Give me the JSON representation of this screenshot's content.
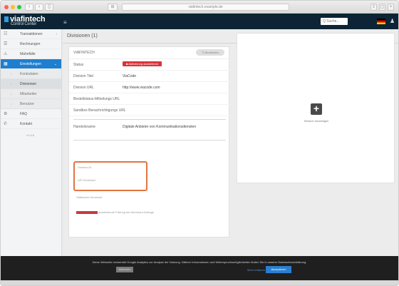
{
  "browser": {
    "url": "viafintech.example.de",
    "tab_icon": "⊞"
  },
  "header": {
    "logo_text": "viafintech",
    "logo_sub": "Control Center",
    "search_placeholder": "Q Suche...",
    "flag": "DE"
  },
  "sidebar": {
    "items": [
      {
        "icon": "☷",
        "label": "Transaktionen",
        "chev": "›"
      },
      {
        "icon": "☰",
        "label": "Rechnungen",
        "chev": ""
      },
      {
        "icon": "⚠",
        "label": "Mahnfälle",
        "chev": ""
      },
      {
        "icon": "▦",
        "label": "Einstellungen",
        "chev": "⌄"
      }
    ],
    "sub_items": [
      {
        "label": "Kontodaten"
      },
      {
        "label": "Divisionen"
      },
      {
        "label": "Mitarbeiter"
      },
      {
        "label": "Benutzer"
      }
    ],
    "bottom_items": [
      {
        "icon": "⚙",
        "label": "FAQ"
      },
      {
        "icon": "✆",
        "label": "Kontakt"
      }
    ],
    "version": "v1.4.8"
  },
  "main": {
    "page_title": "Divisionen (1)",
    "card_title": "VIAFINTECH",
    "edit_button": "✎ Bearbeiten",
    "rows": [
      {
        "key": "Status",
        "value": ""
      },
      {
        "key": "Division Titel",
        "value": "ViaCode"
      },
      {
        "key": "Division URL",
        "value": "http://www.viacode.com"
      },
      {
        "key": "Bestellstatus-Mitteilungs URL",
        "value": ""
      },
      {
        "key": "Sandbox Benachrichtigungs URL",
        "value": ""
      },
      {
        "key": "Handelsname",
        "value": "Digitale Anbieter von Kommunikationsdiensten"
      }
    ],
    "status_badge": "■ Aktivierung ausstehend",
    "highlight_labels": [
      "Division-ID",
      "API-Schlüssel"
    ],
    "key_label": "Statisches Kennwort",
    "red_line_label": "ausstehende Prüfung der Merchant-Anfrage",
    "add_label": "Division hinzufügen"
  },
  "cookie": {
    "text": "Diese Webseite verwendet Google Analytics zur Analyse der Nutzung. Nähere Informationen und Widerspruchsmöglichkeiten finden Sie in unserer Datenschutzerklärung.",
    "decline_button": "Ablehnen",
    "more_link": "Mehr erfahren",
    "accept_button": "Akzeptieren"
  }
}
